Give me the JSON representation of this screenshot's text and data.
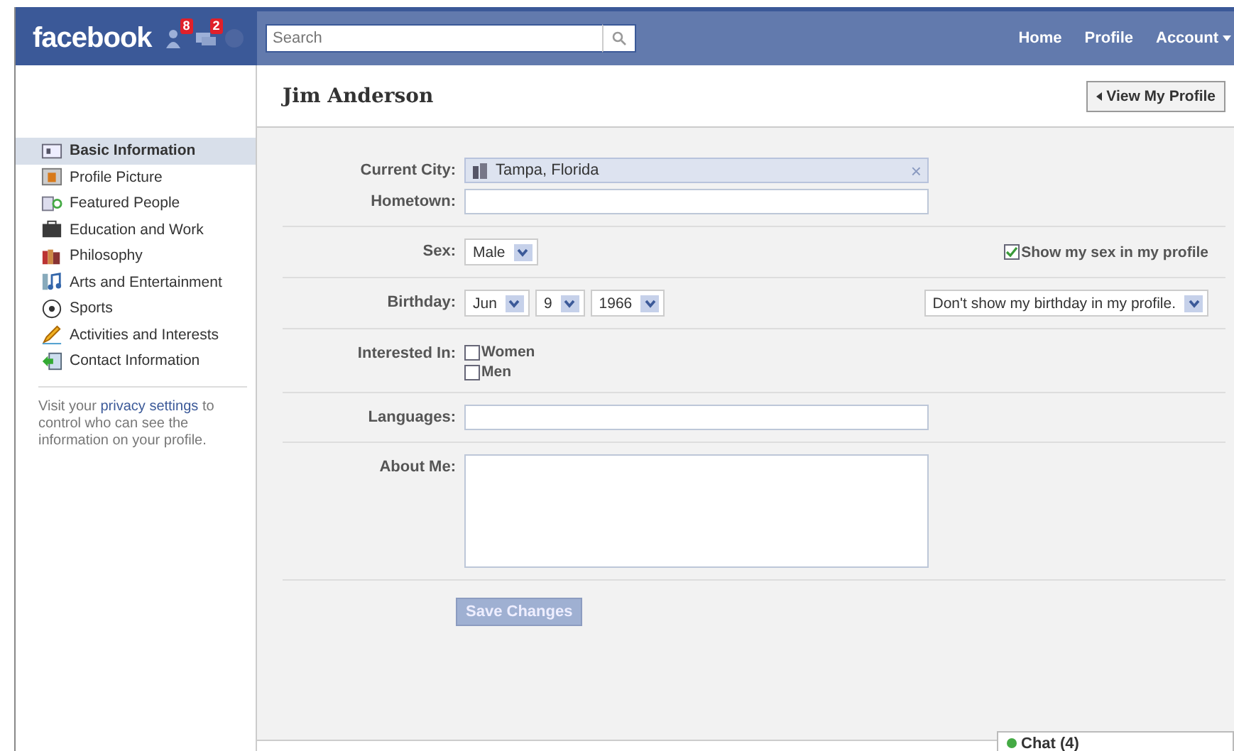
{
  "header": {
    "logo": "facebook",
    "badges": [
      "8",
      "2"
    ],
    "search": {
      "placeholder": "Search"
    },
    "nav": [
      "Home",
      "Profile",
      "Account"
    ]
  },
  "sidebar": {
    "items": [
      {
        "label": "Basic Information",
        "selected": true
      },
      {
        "label": "Profile Picture",
        "selected": false
      },
      {
        "label": "Featured People",
        "selected": false
      },
      {
        "label": "Education and Work",
        "selected": false
      },
      {
        "label": "Philosophy",
        "selected": false
      },
      {
        "label": "Arts and Entertainment",
        "selected": false
      },
      {
        "label": "Sports",
        "selected": false
      },
      {
        "label": "Activities and Interests",
        "selected": false
      },
      {
        "label": "Contact Information",
        "selected": false
      }
    ],
    "note": {
      "before": "Visit your",
      "link": "privacy settings",
      "after": "to control who can see the information on your profile."
    }
  },
  "page": {
    "title": "Jim Anderson",
    "view_button": "View My Profile"
  },
  "form": {
    "sections": [
      {
        "rows": [
          {
            "kind": "token",
            "label": "Current City:",
            "value": "Tampa, Florida",
            "remove": "×"
          },
          {
            "kind": "text",
            "label": "Hometown:"
          }
        ]
      },
      {
        "rows": [
          {
            "kind": "selects",
            "label": "Sex:",
            "selects": [
              "Male"
            ]
          }
        ],
        "side": {
          "kind": "checkbox",
          "label": "Show my sex in my profile",
          "checked": true
        }
      },
      {
        "rows": [
          {
            "kind": "selects",
            "label": "Birthday:",
            "selects": [
              "Jun",
              "9",
              "1966"
            ]
          }
        ],
        "side": {
          "kind": "select",
          "value": "Don't show my birthday in my profile."
        }
      },
      {
        "rows": [
          {
            "kind": "checkboxes",
            "label": "Interested In:",
            "options": [
              {
                "label": "Women",
                "checked": false
              },
              {
                "label": "Men",
                "checked": false
              }
            ]
          }
        ]
      },
      {
        "rows": [
          {
            "kind": "text",
            "label": "Languages:"
          }
        ]
      },
      {
        "rows": [
          {
            "kind": "textarea",
            "label": "About Me:"
          }
        ]
      }
    ],
    "save_button": "Save Changes"
  },
  "chat": {
    "label": "Chat (4)"
  }
}
